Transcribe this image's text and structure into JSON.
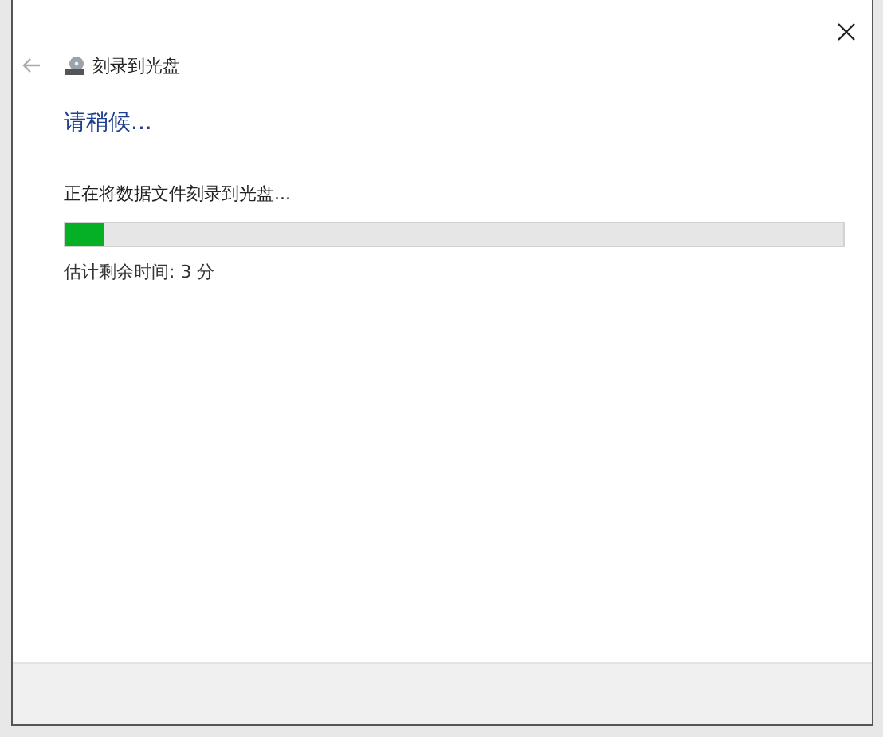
{
  "window": {
    "title": "刻录到光盘"
  },
  "heading": "请稍候...",
  "status": "正在将数据文件刻录到光盘...",
  "progress": {
    "level": 0.05
  },
  "time_remaining": "估计剩余时间: 3 分"
}
